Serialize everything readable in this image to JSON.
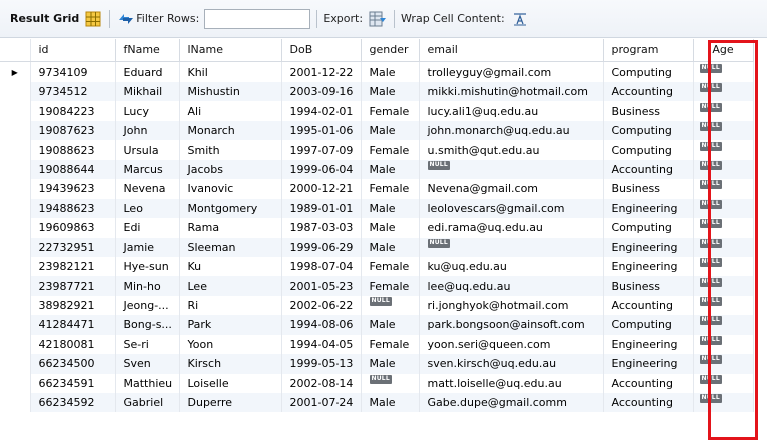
{
  "toolbar": {
    "result_grid_label": "Result Grid",
    "filter_label": "Filter Rows:",
    "filter_value": "",
    "export_label": "Export:",
    "wrap_label": "Wrap Cell Content:"
  },
  "columns": [
    "id",
    "fName",
    "lName",
    "DoB",
    "gender",
    "email",
    "program",
    "Age"
  ],
  "null_label": "NULL",
  "rows": [
    {
      "id": "9734109",
      "fName": "Eduard",
      "lName": "Khil",
      "dob": "2001-12-22",
      "gender": "Male",
      "email": "trolleyguy@gmail.com",
      "program": "Computing",
      "age": "NULL"
    },
    {
      "id": "9734512",
      "fName": "Mikhail",
      "lName": "Mishustin",
      "dob": "2003-09-16",
      "gender": "Male",
      "email": "mikki.mishutin@hotmail.com",
      "program": "Accounting",
      "age": "NULL"
    },
    {
      "id": "19084223",
      "fName": "Lucy",
      "lName": "Ali",
      "dob": "1994-02-01",
      "gender": "Female",
      "email": "lucy.ali1@uq.edu.au",
      "program": "Business",
      "age": "NULL"
    },
    {
      "id": "19087623",
      "fName": "John",
      "lName": "Monarch",
      "dob": "1995-01-06",
      "gender": "Male",
      "email": "john.monarch@uq.edu.au",
      "program": "Computing",
      "age": "NULL"
    },
    {
      "id": "19088623",
      "fName": "Ursula",
      "lName": "Smith",
      "dob": "1997-07-09",
      "gender": "Female",
      "email": "u.smith@qut.edu.au",
      "program": "Computing",
      "age": "NULL"
    },
    {
      "id": "19088644",
      "fName": "Marcus",
      "lName": "Jacobs",
      "dob": "1999-06-04",
      "gender": "Male",
      "email": "NULL",
      "program": "Accounting",
      "age": "NULL"
    },
    {
      "id": "19439623",
      "fName": "Nevena",
      "lName": "Ivanovic",
      "dob": "2000-12-21",
      "gender": "Female",
      "email": "Nevena@gmail.com",
      "program": "Business",
      "age": "NULL"
    },
    {
      "id": "19488623",
      "fName": "Leo",
      "lName": "Montgomery",
      "dob": "1989-01-01",
      "gender": "Male",
      "email": "leolovescars@gmail.com",
      "program": "Engineering",
      "age": "NULL"
    },
    {
      "id": "19609863",
      "fName": "Edi",
      "lName": "Rama",
      "dob": "1987-03-03",
      "gender": "Male",
      "email": "edi.rama@uq.edu.au",
      "program": "Computing",
      "age": "NULL"
    },
    {
      "id": "22732951",
      "fName": "Jamie",
      "lName": "Sleeman",
      "dob": "1999-06-29",
      "gender": "Male",
      "email": "NULL",
      "program": "Engineering",
      "age": "NULL"
    },
    {
      "id": "23982121",
      "fName": "Hye-sun",
      "lName": "Ku",
      "dob": "1998-07-04",
      "gender": "Female",
      "email": "ku@uq.edu.au",
      "program": "Engineering",
      "age": "NULL"
    },
    {
      "id": "23987721",
      "fName": "Min-ho",
      "lName": "Lee",
      "dob": "2001-05-23",
      "gender": "Female",
      "email": "lee@uq.edu.au",
      "program": "Business",
      "age": "NULL"
    },
    {
      "id": "38982921",
      "fName": "Jeong-...",
      "lName": "Ri",
      "dob": "2002-06-22",
      "gender": "NULL",
      "email": "ri.jonghyok@hotmail.com",
      "program": "Accounting",
      "age": "NULL"
    },
    {
      "id": "41284471",
      "fName": "Bong-s...",
      "lName": "Park",
      "dob": "1994-08-06",
      "gender": "Male",
      "email": "park.bongsoon@ainsoft.com",
      "program": "Computing",
      "age": "NULL"
    },
    {
      "id": "42180081",
      "fName": "Se-ri",
      "lName": "Yoon",
      "dob": "1994-04-05",
      "gender": "Female",
      "email": "yoon.seri@queen.com",
      "program": "Engineering",
      "age": "NULL"
    },
    {
      "id": "66234500",
      "fName": "Sven",
      "lName": "Kirsch",
      "dob": "1999-05-13",
      "gender": "Male",
      "email": "sven.kirsch@uq.edu.au",
      "program": "Engineering",
      "age": "NULL"
    },
    {
      "id": "66234591",
      "fName": "Matthieu",
      "lName": "Loiselle",
      "dob": "2002-08-14",
      "gender": "NULL",
      "email": "matt.loiselle@uq.edu.au",
      "program": "Accounting",
      "age": "NULL"
    },
    {
      "id": "66234592",
      "fName": "Gabriel",
      "lName": "Duperre",
      "dob": "2001-07-24",
      "gender": "Male",
      "email": "Gabe.dupe@gmail.comm",
      "program": "Accounting",
      "age": "NULL"
    }
  ],
  "highlight_color": "#e3141b",
  "null_badge_color": "#6b7076"
}
